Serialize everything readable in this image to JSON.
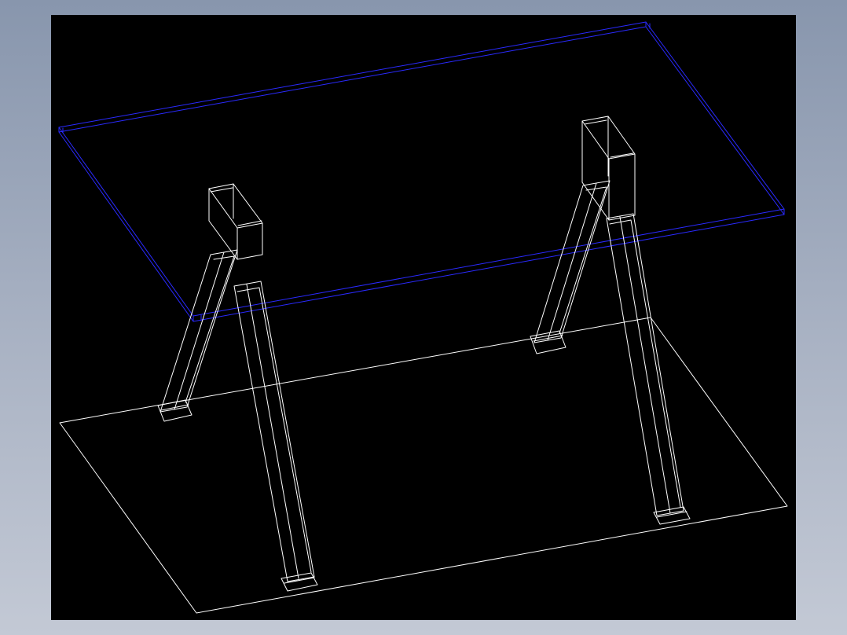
{
  "colors": {
    "background_gradient_top": "#8896ad",
    "background_gradient_bottom": "#c3c9d5",
    "viewport": "#000000",
    "tabletop_edges": "#2a2aff",
    "frame_edges": "#ffffff"
  },
  "scene": {
    "view": "isometric-wireframe",
    "objects": [
      "tabletop",
      "left-trestle",
      "right-trestle",
      "floor-plane"
    ]
  }
}
